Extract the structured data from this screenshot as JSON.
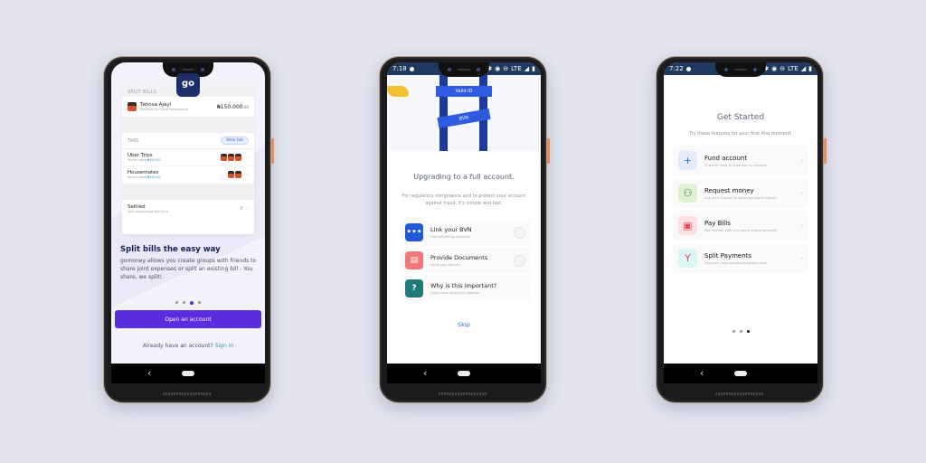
{
  "background_color": "#e3e4f0",
  "phone1": {
    "logo_text": "go",
    "split_bills_header": "SPLIT BILLS",
    "bill": {
      "name": "Tahosa Ajayi",
      "sub": "Request for: Bose headphones",
      "amount": "₦150,000",
      "amount_decimals": ".00"
    },
    "tabs_header": "TABS",
    "new_tab_label": "New tab",
    "tabs": [
      {
        "name": "Uber Trips",
        "sub_prefix": "You're owed ",
        "sub_amount": "₦300.00"
      },
      {
        "name": "Housemates",
        "sub_prefix": "You're owed ",
        "sub_amount": "₦300.00"
      }
    ],
    "settled": {
      "name": "Settled",
      "sub": "Your closed tabs live here.",
      "count": "8"
    },
    "title": "Split bills the easy way",
    "description": "gomoney allows you create groups with friends to share joint expenses or split an existing bill - You share, we split!.",
    "pager": {
      "total": 4,
      "active": 2
    },
    "primary_button": "Open an account",
    "signin_prefix": "Already have an account?",
    "signin_link": "Sign in",
    "accent_color": "#5b2be0"
  },
  "phone2": {
    "status": {
      "time": "7:18",
      "network": "LTE"
    },
    "illustration": {
      "band1": "Valid ID",
      "band2": "BVN"
    },
    "title": "Upgrading to a full account.",
    "description": "For regulatory compliance and to protect your account against fraud, it's simple and fast.",
    "steps": [
      {
        "title": "Link your BVN",
        "sub": "Find everything gomoney",
        "icon": "id-card-icon",
        "color": "#2158d8",
        "glyph": "•••",
        "has_radio": true
      },
      {
        "title": "Provide Documents",
        "sub": "Verify your identity",
        "icon": "document-icon",
        "color": "#f07a7a",
        "glyph": "▤",
        "has_radio": true
      },
      {
        "title": "Why is this important?",
        "sub": "Learn more about this upgrade",
        "icon": "question-icon",
        "color": "#1d7c78",
        "glyph": "?",
        "has_radio": false
      }
    ],
    "skip_label": "Skip"
  },
  "phone3": {
    "status": {
      "time": "7:22",
      "network": "LTE"
    },
    "title": "Get Started",
    "description": "Try these features for your first Aha moment!",
    "features": [
      {
        "title": "Fund account",
        "sub": "The first step to spending is funding",
        "icon": "plus-icon",
        "bg": "#e3ecfd",
        "fg": "#3b6bd6",
        "glyph": "+"
      },
      {
        "title": "Request money",
        "sub": "Ask your friends to send you some money",
        "icon": "people-icon",
        "bg": "#dff3d4",
        "fg": "#2c7a3a",
        "glyph": "⚇"
      },
      {
        "title": "Pay Bills",
        "sub": "Get started with our value added services",
        "icon": "bill-icon",
        "bg": "#fde0e0",
        "fg": "#e44d5a",
        "glyph": "▣"
      },
      {
        "title": "Split Payments",
        "sub": "Discover how shared expenses work",
        "icon": "split-icon",
        "bg": "#dcf6f6",
        "fg": "#e0505a",
        "glyph": "Y"
      }
    ],
    "pager": {
      "total": 3,
      "active": 2
    }
  }
}
